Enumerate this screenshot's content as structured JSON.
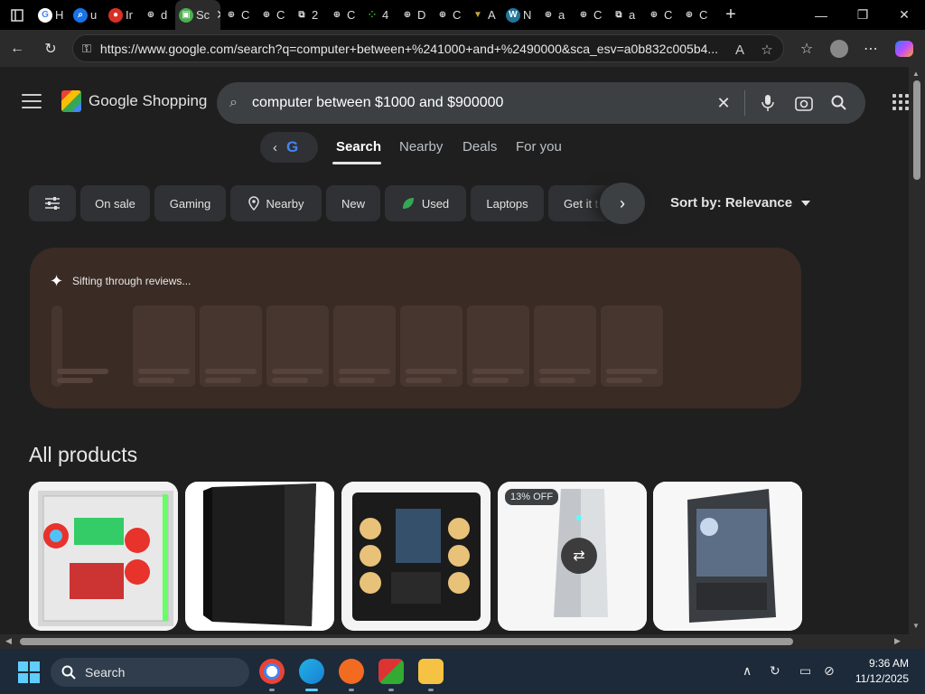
{
  "browser": {
    "tabs": [
      {
        "label": "H",
        "icon": "google-icon"
      },
      {
        "label": "u",
        "icon": "search-icon"
      },
      {
        "label": "Ir",
        "icon": "red-circle-icon"
      },
      {
        "label": "d",
        "icon": "globe-icon"
      },
      {
        "label": "Sc",
        "icon": "monitor-icon",
        "active": true
      },
      {
        "label": "C",
        "icon": "globe-icon"
      },
      {
        "label": "C",
        "icon": "globe-icon"
      },
      {
        "label": "2",
        "icon": "extension-icon"
      },
      {
        "label": "C",
        "icon": "globe-icon"
      },
      {
        "label": "4",
        "icon": "dots-icon"
      },
      {
        "label": "D",
        "icon": "globe-icon"
      },
      {
        "label": "C",
        "icon": "globe-icon"
      },
      {
        "label": "A",
        "icon": "triangle-icon"
      },
      {
        "label": "N",
        "icon": "wordpress-icon"
      },
      {
        "label": "a",
        "icon": "globe-icon"
      },
      {
        "label": "C",
        "icon": "globe-icon"
      },
      {
        "label": "a",
        "icon": "extension-icon"
      },
      {
        "label": "C",
        "icon": "globe-icon"
      },
      {
        "label": "C",
        "icon": "globe-icon"
      }
    ],
    "url": "https://www.google.com/search?q=computer+between+%241000+and+%2490000&sca_esv=a0b832c005b4..."
  },
  "header": {
    "logo_text": "Google Shopping",
    "query": "computer between $1000 and $900000"
  },
  "nav": {
    "tabs": [
      "Search",
      "Nearby",
      "Deals",
      "For you"
    ],
    "active": "Search"
  },
  "filters": {
    "chips": [
      "On sale",
      "Gaming",
      "Nearby",
      "New",
      "Used",
      "Laptops",
      "Get it t"
    ],
    "sort_label": "Sort by: Relevance"
  },
  "ai_panel": {
    "status": "Sifting through reviews..."
  },
  "products": {
    "heading": "All products",
    "items": [
      {
        "name": "white-rgb-pc-case"
      },
      {
        "name": "black-tower-pc"
      },
      {
        "name": "dual-chamber-pc"
      },
      {
        "name": "silver-tower-pc",
        "badge": "13% OFF"
      },
      {
        "name": "black-mesh-pc"
      }
    ]
  },
  "taskbar": {
    "search_label": "Search",
    "time": "9:36 AM",
    "date": "11/12/2025"
  },
  "colors": {
    "page_bg": "#1f1f1f",
    "ai_panel_bg": "#3a2b24",
    "search_bg": "#3c4043"
  }
}
